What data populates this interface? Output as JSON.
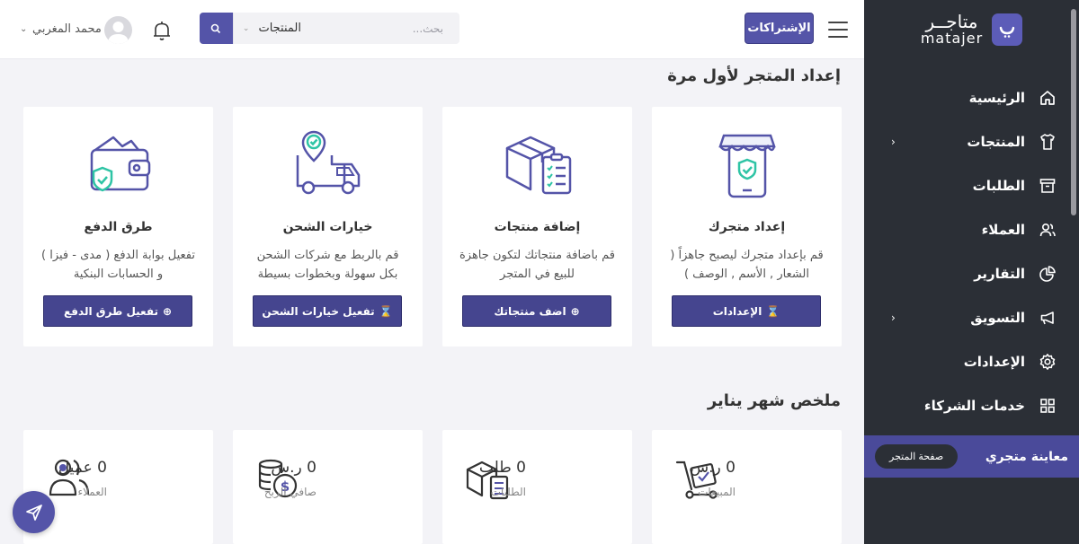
{
  "brand": {
    "logo_ar": "متاجــر",
    "logo_en": "matajer"
  },
  "sidebar": {
    "items": [
      {
        "label": "الرئيسية",
        "icon": "home-icon",
        "has_sub": false
      },
      {
        "label": "المنتجات",
        "icon": "shirt-icon",
        "has_sub": true
      },
      {
        "label": "الطلبات",
        "icon": "archive-icon",
        "has_sub": false
      },
      {
        "label": "العملاء",
        "icon": "users-icon",
        "has_sub": false
      },
      {
        "label": "التقارير",
        "icon": "pie-chart-icon",
        "has_sub": false
      },
      {
        "label": "التسويق",
        "icon": "megaphone-icon",
        "has_sub": true
      },
      {
        "label": "الإعدادات",
        "icon": "gear-icon",
        "has_sub": false
      },
      {
        "label": "خدمات الشركاء",
        "icon": "grid-icon",
        "has_sub": false
      }
    ],
    "preview_label": "معاينة متجري",
    "store_page_button": "صفحة المتجر"
  },
  "topbar": {
    "subscriptions_button": "الإشتراكات",
    "search": {
      "placeholder": "بحث...",
      "category": "المنتجات"
    },
    "user_name": "محمد المغربي"
  },
  "setup": {
    "title": "إعداد المتجر لأول مرة",
    "cards": [
      {
        "title": "إعداد متجرك",
        "desc": "قم بإعداد متجرك ليصبح جاهزاً ( الشعار , الأسم , الوصف )",
        "button": "الإعدادات",
        "button_glyph": "⌛"
      },
      {
        "title": "إضافة منتجات",
        "desc": "قم باضافة منتجاتك لتكون جاهزة للبيع في المتجر",
        "button": "اضف منتجاتك",
        "button_glyph": "⊕"
      },
      {
        "title": "خيارات الشحن",
        "desc": "قم بالربط مع شركات الشحن بكل سهولة وبخطوات بسيطة",
        "button": "تفعيل خيارات الشحن",
        "button_glyph": "⌛"
      },
      {
        "title": "طرق الدفع",
        "desc": "تفعيل بوابة الدفع ( مدى - فيزا ) و الحسابات البنكية",
        "button": "تفعيل طرق الدفع",
        "button_glyph": "⊕"
      }
    ]
  },
  "summary": {
    "title": "ملخص شهر يناير",
    "stats": [
      {
        "value": "0 ر.س",
        "label": "المبيعات",
        "icon": "cart-icon"
      },
      {
        "value": "0 طلب",
        "label": "الطلبات",
        "icon": "box-icon"
      },
      {
        "value": "0 ر.س",
        "label": "صافي الربح",
        "icon": "coins-icon"
      },
      {
        "value": "0 عميل",
        "label": "العملاء",
        "icon": "users-icon"
      }
    ]
  },
  "colors": {
    "primary": "#5454a8",
    "sidebar": "#2b2f36",
    "accent_green": "#2ec4a5"
  }
}
